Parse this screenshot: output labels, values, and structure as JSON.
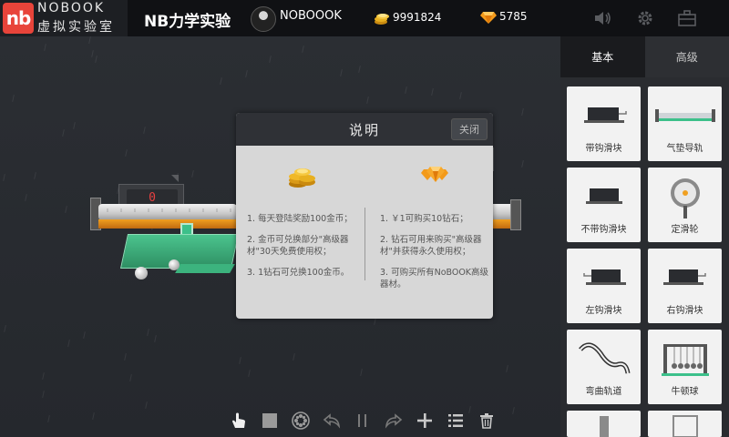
{
  "header": {
    "logo_mark": "nb",
    "logo_en": "NOBOOK",
    "logo_cn": "虚拟实验室",
    "app_title": "NB力学实验",
    "username": "NOBOOOK",
    "coins": "9991824",
    "gems": "5785",
    "icons": [
      "sound-icon",
      "gear-icon",
      "toolbox-icon"
    ]
  },
  "stage": {
    "counter_value": "0"
  },
  "toolbar": {
    "icons": [
      "hand-icon",
      "stop-icon",
      "film-reel-icon",
      "undo-icon",
      "pause-icon",
      "redo-icon",
      "add-icon",
      "list-icon",
      "trash-icon"
    ]
  },
  "dialog": {
    "title": "说明",
    "close_label": "关闭",
    "left": {
      "icon": "gold-coins-icon",
      "lines": [
        "1. 每天登陆奖励100金币；",
        "2. 金币可兑换部分\"高级器材\"30天免费使用权；",
        "3. 1钻石可兑换100金币。"
      ]
    },
    "right": {
      "icon": "diamonds-icon",
      "lines": [
        "1. ￥1可购买10钻石；",
        "2. 钻石可用来购买\"高级器材\"并获得永久使用权；",
        "3. 可购买所有NoBOOK高级器材。"
      ]
    }
  },
  "panel": {
    "tabs": [
      {
        "label": "基本",
        "active": true
      },
      {
        "label": "高级",
        "active": false
      }
    ],
    "items": [
      {
        "label": "带钩滑块",
        "icon": "hook-slider-icon"
      },
      {
        "label": "气垫导轨",
        "icon": "air-track-icon"
      },
      {
        "label": "不带钩滑块",
        "icon": "slider-icon"
      },
      {
        "label": "定滑轮",
        "icon": "pulley-icon"
      },
      {
        "label": "左钩滑块",
        "icon": "left-hook-slider-icon"
      },
      {
        "label": "右钩滑块",
        "icon": "right-hook-slider-icon"
      },
      {
        "label": "弯曲轨道",
        "icon": "curved-track-icon"
      },
      {
        "label": "牛顿球",
        "icon": "newton-cradle-icon"
      }
    ],
    "collapse_glyph": "›"
  },
  "colors": {
    "accent_red": "#e8443a",
    "counter_red": "#e84040",
    "rail_orange": "#f0a020",
    "platform_green": "#3cc08a"
  }
}
